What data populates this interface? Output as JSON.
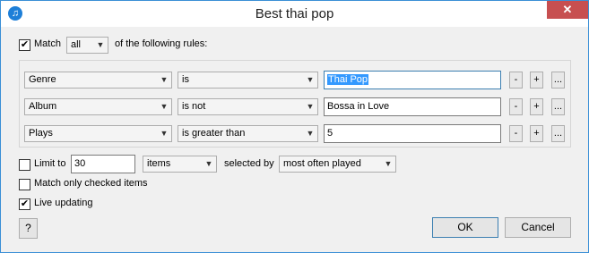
{
  "window": {
    "title": "Best thai pop",
    "close_label": "✕",
    "app_icon": "music-note-icon"
  },
  "match": {
    "checked": true,
    "label": "Match",
    "mode": "all",
    "suffix": "of the following rules:"
  },
  "rules": [
    {
      "field": "Genre",
      "operator": "is",
      "value": "Thai Pop"
    },
    {
      "field": "Album",
      "operator": "is not",
      "value": "Bossa in Love"
    },
    {
      "field": "Plays",
      "operator": "is greater than",
      "value": "5"
    }
  ],
  "rule_buttons": {
    "remove": "-",
    "add": "+",
    "more": "..."
  },
  "limit": {
    "checked": false,
    "label": "Limit to",
    "value": "30",
    "unit": "items",
    "selected_by_label": "selected by",
    "selected_by": "most often played"
  },
  "match_checked": {
    "checked": false,
    "label": "Match only checked items"
  },
  "live_updating": {
    "checked": true,
    "label": "Live updating"
  },
  "buttons": {
    "help": "?",
    "ok": "OK",
    "cancel": "Cancel"
  }
}
